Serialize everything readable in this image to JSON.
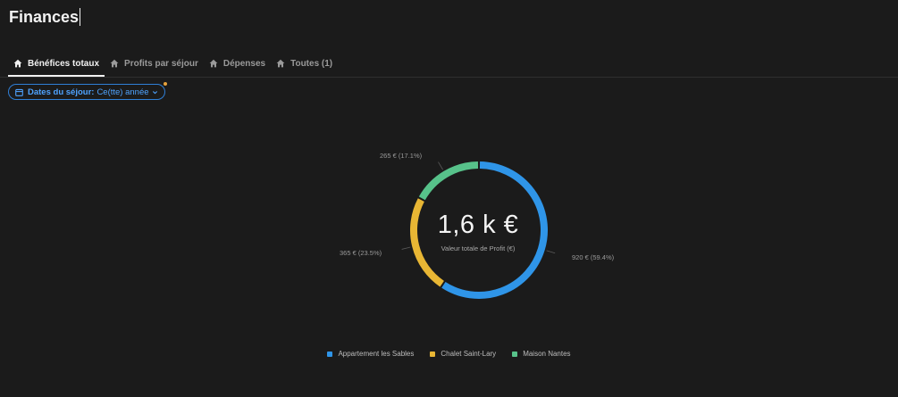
{
  "page": {
    "title": "Finances"
  },
  "tabs": [
    {
      "label": "Bénéfices totaux",
      "active": true,
      "icon": "home-icon"
    },
    {
      "label": "Profits par séjour",
      "active": false,
      "icon": "home-icon"
    },
    {
      "label": "Dépenses",
      "active": false,
      "icon": "home-icon"
    },
    {
      "label": "Toutes (1)",
      "active": false,
      "icon": "home-icon"
    }
  ],
  "filter": {
    "label": "Dates du séjour:",
    "value": "Ce(tte) année",
    "icon": "calendar-icon",
    "indicator_color": "#e6a23c"
  },
  "chart": {
    "center_value": "1,6 k €",
    "center_caption": "Valeur totale de Profit (€)"
  },
  "chart_data": {
    "type": "pie",
    "categories": [
      "Appartement les Sables",
      "Chalet Saint-Lary",
      "Maison Nantes"
    ],
    "values": [
      920,
      365,
      265
    ],
    "labels": [
      "920 € (59.4%)",
      "365 € (23.5%)",
      "265 € (17.1%)"
    ],
    "colors": [
      "#2f95e8",
      "#e8b634",
      "#57c28a"
    ],
    "legend": "bottom"
  },
  "colors": {
    "accent": "#2f7fd6",
    "background": "#1b1b1b"
  }
}
